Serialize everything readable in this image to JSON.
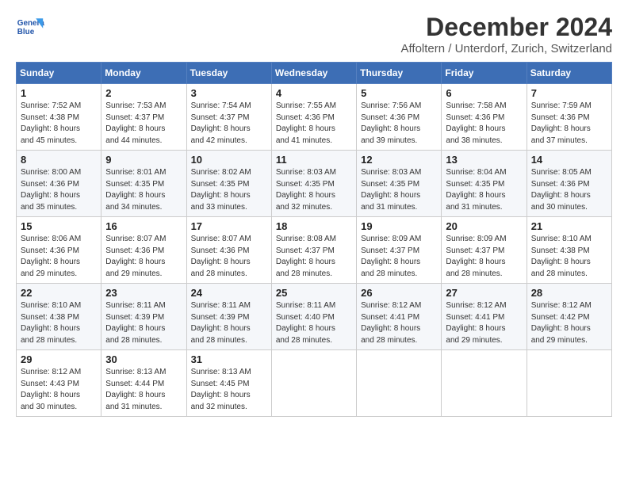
{
  "header": {
    "logo_line1": "General",
    "logo_line2": "Blue",
    "title": "December 2024",
    "subtitle": "Affoltern / Unterdorf, Zurich, Switzerland"
  },
  "weekdays": [
    "Sunday",
    "Monday",
    "Tuesday",
    "Wednesday",
    "Thursday",
    "Friday",
    "Saturday"
  ],
  "weeks": [
    [
      {
        "day": "1",
        "info": "Sunrise: 7:52 AM\nSunset: 4:38 PM\nDaylight: 8 hours\nand 45 minutes."
      },
      {
        "day": "2",
        "info": "Sunrise: 7:53 AM\nSunset: 4:37 PM\nDaylight: 8 hours\nand 44 minutes."
      },
      {
        "day": "3",
        "info": "Sunrise: 7:54 AM\nSunset: 4:37 PM\nDaylight: 8 hours\nand 42 minutes."
      },
      {
        "day": "4",
        "info": "Sunrise: 7:55 AM\nSunset: 4:36 PM\nDaylight: 8 hours\nand 41 minutes."
      },
      {
        "day": "5",
        "info": "Sunrise: 7:56 AM\nSunset: 4:36 PM\nDaylight: 8 hours\nand 39 minutes."
      },
      {
        "day": "6",
        "info": "Sunrise: 7:58 AM\nSunset: 4:36 PM\nDaylight: 8 hours\nand 38 minutes."
      },
      {
        "day": "7",
        "info": "Sunrise: 7:59 AM\nSunset: 4:36 PM\nDaylight: 8 hours\nand 37 minutes."
      }
    ],
    [
      {
        "day": "8",
        "info": "Sunrise: 8:00 AM\nSunset: 4:36 PM\nDaylight: 8 hours\nand 35 minutes."
      },
      {
        "day": "9",
        "info": "Sunrise: 8:01 AM\nSunset: 4:35 PM\nDaylight: 8 hours\nand 34 minutes."
      },
      {
        "day": "10",
        "info": "Sunrise: 8:02 AM\nSunset: 4:35 PM\nDaylight: 8 hours\nand 33 minutes."
      },
      {
        "day": "11",
        "info": "Sunrise: 8:03 AM\nSunset: 4:35 PM\nDaylight: 8 hours\nand 32 minutes."
      },
      {
        "day": "12",
        "info": "Sunrise: 8:03 AM\nSunset: 4:35 PM\nDaylight: 8 hours\nand 31 minutes."
      },
      {
        "day": "13",
        "info": "Sunrise: 8:04 AM\nSunset: 4:35 PM\nDaylight: 8 hours\nand 31 minutes."
      },
      {
        "day": "14",
        "info": "Sunrise: 8:05 AM\nSunset: 4:36 PM\nDaylight: 8 hours\nand 30 minutes."
      }
    ],
    [
      {
        "day": "15",
        "info": "Sunrise: 8:06 AM\nSunset: 4:36 PM\nDaylight: 8 hours\nand 29 minutes."
      },
      {
        "day": "16",
        "info": "Sunrise: 8:07 AM\nSunset: 4:36 PM\nDaylight: 8 hours\nand 29 minutes."
      },
      {
        "day": "17",
        "info": "Sunrise: 8:07 AM\nSunset: 4:36 PM\nDaylight: 8 hours\nand 28 minutes."
      },
      {
        "day": "18",
        "info": "Sunrise: 8:08 AM\nSunset: 4:37 PM\nDaylight: 8 hours\nand 28 minutes."
      },
      {
        "day": "19",
        "info": "Sunrise: 8:09 AM\nSunset: 4:37 PM\nDaylight: 8 hours\nand 28 minutes."
      },
      {
        "day": "20",
        "info": "Sunrise: 8:09 AM\nSunset: 4:37 PM\nDaylight: 8 hours\nand 28 minutes."
      },
      {
        "day": "21",
        "info": "Sunrise: 8:10 AM\nSunset: 4:38 PM\nDaylight: 8 hours\nand 28 minutes."
      }
    ],
    [
      {
        "day": "22",
        "info": "Sunrise: 8:10 AM\nSunset: 4:38 PM\nDaylight: 8 hours\nand 28 minutes."
      },
      {
        "day": "23",
        "info": "Sunrise: 8:11 AM\nSunset: 4:39 PM\nDaylight: 8 hours\nand 28 minutes."
      },
      {
        "day": "24",
        "info": "Sunrise: 8:11 AM\nSunset: 4:39 PM\nDaylight: 8 hours\nand 28 minutes."
      },
      {
        "day": "25",
        "info": "Sunrise: 8:11 AM\nSunset: 4:40 PM\nDaylight: 8 hours\nand 28 minutes."
      },
      {
        "day": "26",
        "info": "Sunrise: 8:12 AM\nSunset: 4:41 PM\nDaylight: 8 hours\nand 28 minutes."
      },
      {
        "day": "27",
        "info": "Sunrise: 8:12 AM\nSunset: 4:41 PM\nDaylight: 8 hours\nand 29 minutes."
      },
      {
        "day": "28",
        "info": "Sunrise: 8:12 AM\nSunset: 4:42 PM\nDaylight: 8 hours\nand 29 minutes."
      }
    ],
    [
      {
        "day": "29",
        "info": "Sunrise: 8:12 AM\nSunset: 4:43 PM\nDaylight: 8 hours\nand 30 minutes."
      },
      {
        "day": "30",
        "info": "Sunrise: 8:13 AM\nSunset: 4:44 PM\nDaylight: 8 hours\nand 31 minutes."
      },
      {
        "day": "31",
        "info": "Sunrise: 8:13 AM\nSunset: 4:45 PM\nDaylight: 8 hours\nand 32 minutes."
      },
      null,
      null,
      null,
      null
    ]
  ]
}
